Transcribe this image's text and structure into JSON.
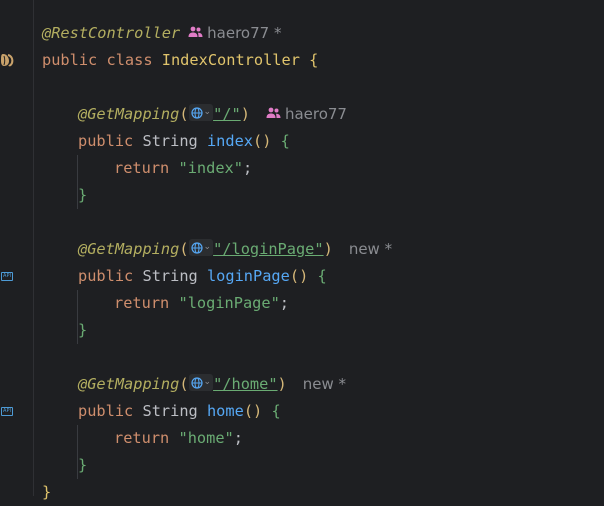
{
  "editor": {
    "lines": {
      "l1": {
        "annotation": "@RestController",
        "author": "haero77 *"
      },
      "l2": {
        "kw_public": "public",
        "kw_class": "class",
        "class_name": "IndexController",
        "brace": "{"
      },
      "l4": {
        "annotation": "@GetMapping",
        "open": "(",
        "path": "\"/\"",
        "close": ")",
        "author": "haero77"
      },
      "l5": {
        "kw_public": "public",
        "type": "String",
        "method": "index",
        "parens": "()",
        "brace": "{"
      },
      "l6": {
        "kw_return": "return",
        "value": "\"index\"",
        "semi": ";"
      },
      "l7": {
        "brace": "}"
      },
      "l9": {
        "annotation": "@GetMapping",
        "open": "(",
        "path": "\"/loginPage\"",
        "close": ")",
        "status": "new *"
      },
      "l10": {
        "kw_public": "public",
        "type": "String",
        "method": "loginPage",
        "parens": "()",
        "brace": "{"
      },
      "l11": {
        "kw_return": "return",
        "value": "\"loginPage\"",
        "semi": ";"
      },
      "l12": {
        "brace": "}"
      },
      "l14": {
        "annotation": "@GetMapping",
        "open": "(",
        "path": "\"/home\"",
        "close": ")",
        "status": "new *"
      },
      "l15": {
        "kw_public": "public",
        "type": "String",
        "method": "home",
        "parens": "()",
        "brace": "{"
      },
      "l16": {
        "kw_return": "return",
        "value": "\"home\"",
        "semi": ";"
      },
      "l17": {
        "brace": "}"
      },
      "l18": {
        "brace": "}"
      }
    },
    "gutter": {
      "api_badge": "API"
    },
    "colors": {
      "background": "#1e1f22",
      "keyword": "#cf8e6d",
      "annotation": "#b3ae60",
      "method": "#56a8f5",
      "string": "#6aab73",
      "text": "#bcbec4",
      "hint": "#8a8c91"
    },
    "icons": [
      "spring-bean-icon",
      "user-group-icon",
      "globe-icon",
      "chevron-down-icon",
      "api-endpoint-icon"
    ]
  }
}
